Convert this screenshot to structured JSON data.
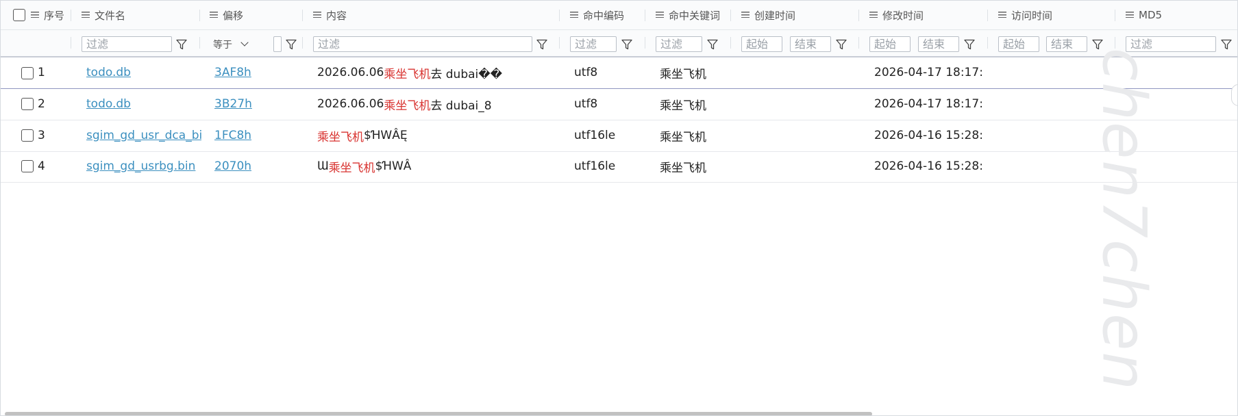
{
  "columns": [
    {
      "key": "index",
      "label": "序号"
    },
    {
      "key": "filename",
      "label": "文件名"
    },
    {
      "key": "offset",
      "label": "偏移"
    },
    {
      "key": "content",
      "label": "内容"
    },
    {
      "key": "encoding",
      "label": "命中编码"
    },
    {
      "key": "keyword",
      "label": "命中关键词"
    },
    {
      "key": "created",
      "label": "创建时间"
    },
    {
      "key": "modified",
      "label": "修改时间"
    },
    {
      "key": "accessed",
      "label": "访问时间"
    },
    {
      "key": "md5",
      "label": "MD5"
    }
  ],
  "filters": {
    "placeholder": "过滤",
    "offset_operator": "等于",
    "start_placeholder": "起始",
    "end_placeholder": "结束"
  },
  "rows": [
    {
      "index": "1",
      "filename": "todo.db",
      "offset": "3AF8h",
      "content_before": "\u0001\u000f2026.06.06 ",
      "content_hit": "乘坐飞机",
      "content_after": "去 dubai\u0001\u0012��",
      "encoding": "utf8",
      "keyword": "乘坐飞机",
      "created": "",
      "modified": "2026-04-17 18:17:...",
      "accessed": "",
      "md5": ""
    },
    {
      "index": "2",
      "filename": "todo.db",
      "offset": "3B27h",
      "content_before": "2026.06.06 ",
      "content_hit": "乘坐飞机",
      "content_after": "去 dubai_\u00138",
      "encoding": "utf8",
      "keyword": "乘坐飞机",
      "created": "",
      "modified": "2026-04-17 18:17:...",
      "accessed": "",
      "md5": ""
    },
    {
      "index": "3",
      "filename": "sgim_gd_usr_dca_bigram.bin",
      "offset": "1FC8h",
      "content_before": "\u0002\u0003\u0004",
      "content_hit": "乘坐飞机",
      "content_after": " \u0005$ꞪW\u0006ÂĘ",
      "encoding": "utf16le",
      "keyword": "乘坐飞机",
      "created": "",
      "modified": "2026-04-16 15:28:...",
      "accessed": "",
      "md5": ""
    },
    {
      "index": "4",
      "filename": "sgim_gd_usrbg.bin",
      "offset": "2070h",
      "content_before": "Ɯ\u0002\u0003\u0004",
      "content_hit": "乘坐飞机",
      "content_after": "\u0005\u0006$ꞪW\u0007Â\b",
      "encoding": "utf16le",
      "keyword": "乘坐飞机",
      "created": "",
      "modified": "2026-04-16 15:28:...",
      "accessed": "",
      "md5": ""
    }
  ],
  "watermark": "chen7chen",
  "colors": {
    "link": "#3b8fbf",
    "highlight": "#d8322f",
    "border": "#e3e6ea"
  }
}
